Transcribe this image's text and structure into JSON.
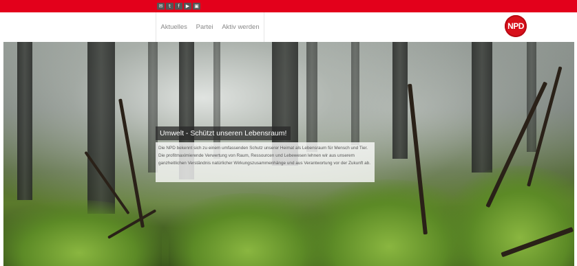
{
  "top_bar": {
    "accent_color": "#e3001b",
    "social_icons": [
      "mail-icon",
      "twitter-icon",
      "facebook-icon",
      "youtube-icon",
      "video-icon"
    ],
    "social_glyphs": [
      "✉",
      "t",
      "f",
      "▶",
      "▣"
    ]
  },
  "nav": {
    "items": [
      {
        "label": "Aktuelles"
      },
      {
        "label": "Partei"
      },
      {
        "label": "Aktiv werden"
      }
    ]
  },
  "logo": {
    "text": "NPD",
    "color": "#d8101b"
  },
  "hero": {
    "headline": "Umwelt - Schützt unseren Lebensraum!",
    "body": "Die NPD bekennt sich zu einem umfassenden Schutz unserer Heimat als Lebensraum für Mensch und Tier. Die profitmaximierende Verwertung von Raum, Ressourcen und Lebewesen lehnen wir aus unserem ganzheitlichen Verständnis natürlicher Wirkungszusammenhänge und aus Verantwortung vor der Zukunft ab."
  }
}
